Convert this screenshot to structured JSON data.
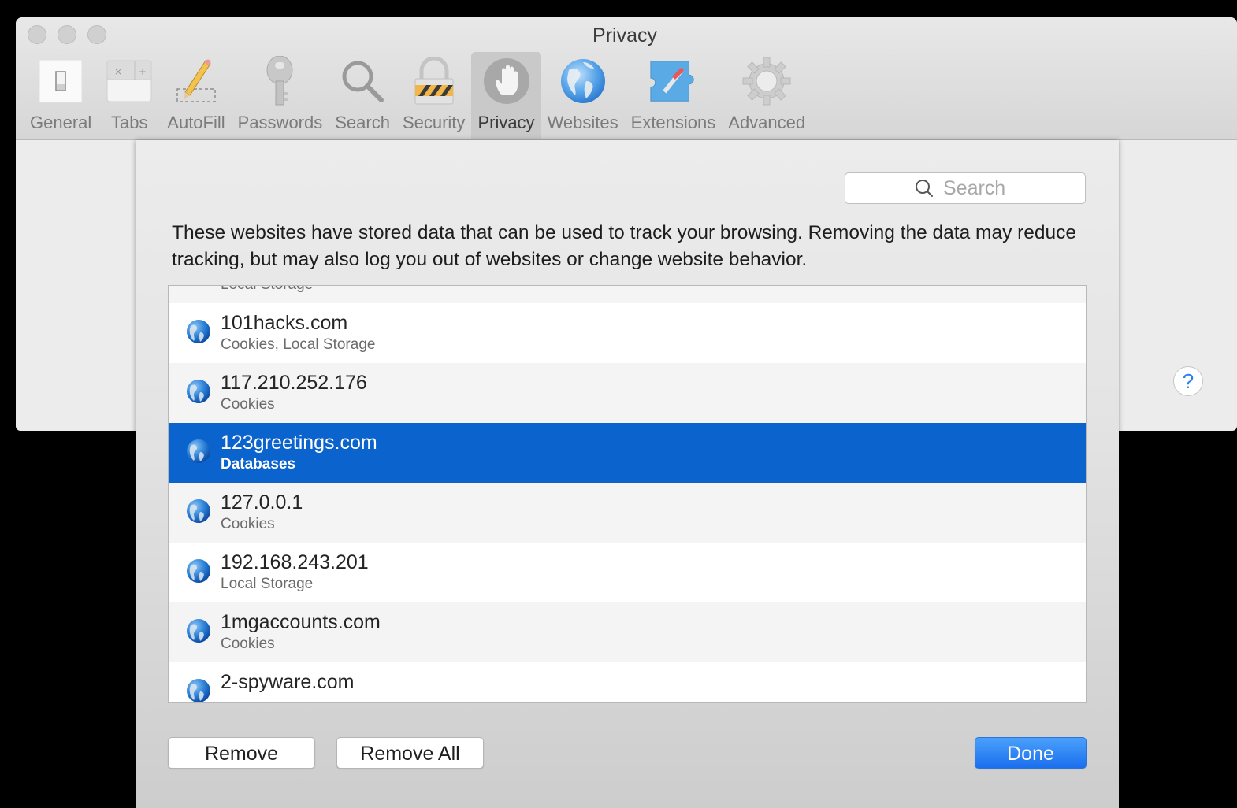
{
  "window": {
    "title": "Privacy",
    "traffic_lights": [
      "close",
      "minimize",
      "zoom"
    ]
  },
  "toolbar": {
    "items": [
      {
        "label": "General",
        "icon": "general-switch-icon",
        "active": false
      },
      {
        "label": "Tabs",
        "icon": "tabs-icon",
        "active": false
      },
      {
        "label": "AutoFill",
        "icon": "pencil-icon",
        "active": false
      },
      {
        "label": "Passwords",
        "icon": "key-icon",
        "active": false
      },
      {
        "label": "Search",
        "icon": "magnifier-icon",
        "active": false
      },
      {
        "label": "Security",
        "icon": "padlock-icon",
        "active": false
      },
      {
        "label": "Privacy",
        "icon": "hand-icon",
        "active": true
      },
      {
        "label": "Websites",
        "icon": "globe-icon",
        "active": false
      },
      {
        "label": "Extensions",
        "icon": "puzzle-compass-icon",
        "active": false
      },
      {
        "label": "Advanced",
        "icon": "gear-icon",
        "active": false
      }
    ]
  },
  "help": {
    "label": "?"
  },
  "sheet": {
    "search": {
      "placeholder": "Search",
      "value": ""
    },
    "description": "These websites have stored data that can be used to track your browsing. Removing the data may reduce tracking, but may also log you out of websites or change website behavior.",
    "websites": [
      {
        "name": "",
        "kind": "Local Storage",
        "selected": false
      },
      {
        "name": "101hacks.com",
        "kind": "Cookies, Local Storage",
        "selected": false
      },
      {
        "name": "117.210.252.176",
        "kind": "Cookies",
        "selected": false
      },
      {
        "name": "123greetings.com",
        "kind": "Databases",
        "selected": true
      },
      {
        "name": "127.0.0.1",
        "kind": "Cookies",
        "selected": false
      },
      {
        "name": "192.168.243.201",
        "kind": "Local Storage",
        "selected": false
      },
      {
        "name": "1mgaccounts.com",
        "kind": "Cookies",
        "selected": false
      },
      {
        "name": "2-spyware.com",
        "kind": "",
        "selected": false
      }
    ],
    "buttons": {
      "remove": "Remove",
      "remove_all": "Remove All",
      "done": "Done"
    }
  },
  "colors": {
    "selection": "#0b63ce",
    "accent": "#1b6fee"
  }
}
